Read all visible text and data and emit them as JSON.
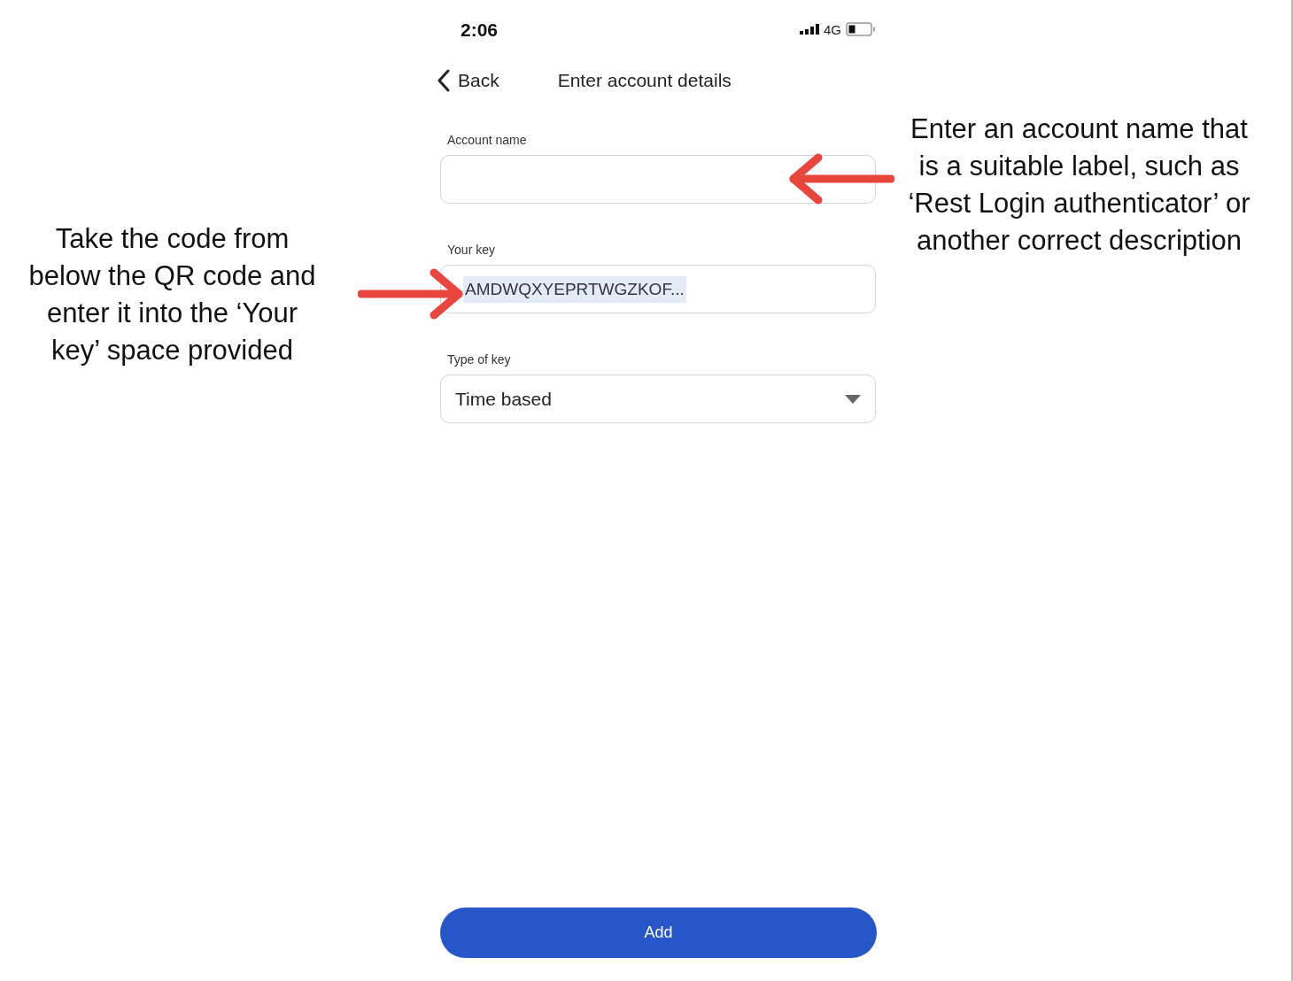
{
  "status_bar": {
    "time": "2:06",
    "network": "4G"
  },
  "nav": {
    "back": "Back",
    "title": "Enter account details"
  },
  "fields": [
    {
      "kind": "text",
      "label": "Account name",
      "selected": false
    },
    {
      "kind": "text",
      "label": "Your key",
      "value": "AMDWQXYEPRTWGZKOF...",
      "selected": true
    },
    {
      "kind": "dropdown",
      "label": "Type of key",
      "value": "Time based"
    }
  ],
  "add_button": "Add",
  "left_note": "Take the code from below the QR code and enter it into the ‘Your key’ space provided",
  "right_note": "Enter an account name that is a suitable label, such as ‘Rest Login authenticator’ or another correct description"
}
